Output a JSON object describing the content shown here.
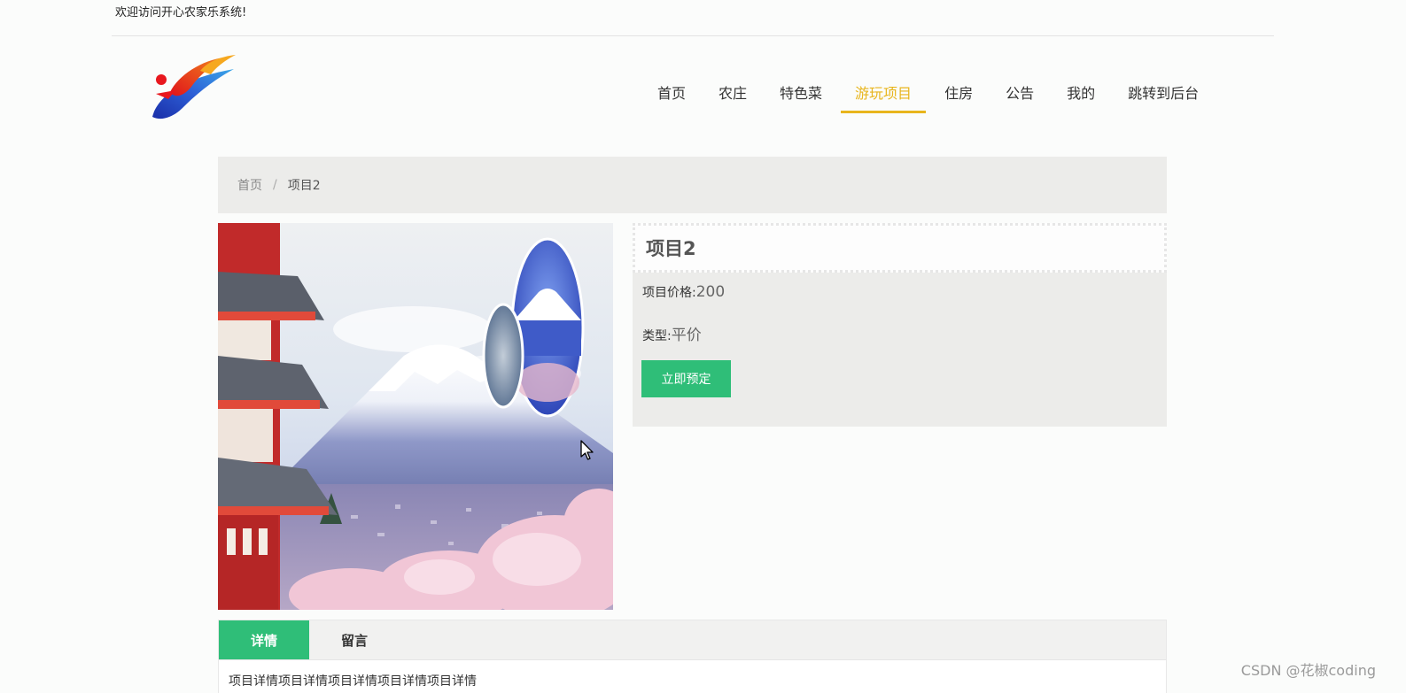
{
  "topbar": {
    "welcome": "欢迎访问开心农家乐系统!"
  },
  "nav": {
    "items": [
      {
        "label": "首页"
      },
      {
        "label": "农庄"
      },
      {
        "label": "特色菜"
      },
      {
        "label": "游玩项目",
        "active": true
      },
      {
        "label": "住房"
      },
      {
        "label": "公告"
      },
      {
        "label": "我的"
      },
      {
        "label": "跳转到后台"
      }
    ],
    "active_color": "#e8b51c"
  },
  "breadcrumb": {
    "home": "首页",
    "separator": "/",
    "current": "项目2"
  },
  "product": {
    "title": "项目2",
    "price_label": "项目价格:",
    "price_value": "200",
    "type_label": "类型:",
    "type_value": "平价",
    "book_button": "立即预定",
    "button_color": "#2fbe78"
  },
  "tabs": {
    "items": [
      {
        "label": "详情",
        "active": true
      },
      {
        "label": "留言"
      }
    ],
    "content": "项目详情项目详情项目详情项目详情项目详情"
  },
  "watermark": "CSDN @花椒coding"
}
